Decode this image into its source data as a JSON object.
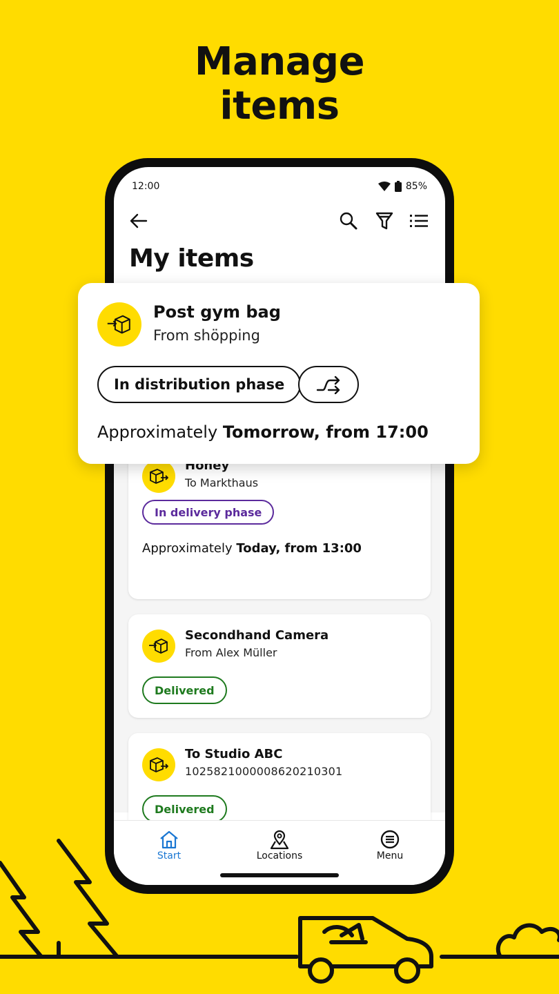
{
  "headline": {
    "line1": "Manage",
    "line2": "items"
  },
  "status_bar": {
    "time": "12:00",
    "battery": "85%"
  },
  "app_bar": {
    "back_icon": "arrow-left-icon",
    "actions": [
      "search-icon",
      "filter-icon",
      "list-icon"
    ]
  },
  "page_title": "My items",
  "featured_item": {
    "title": "Post gym bag",
    "subtitle": "From shöpping",
    "status": "In distribution phase",
    "eta_prefix": "Approximately",
    "eta_value": "Tomorrow, from 17:00",
    "icon": "incoming-package-icon",
    "action_icon": "redirect-icon"
  },
  "items": [
    {
      "title": "Honey",
      "subtitle": "To Markthaus",
      "status": "In delivery phase",
      "eta_prefix": "Approximately",
      "eta_value": "Today, from 13:00",
      "icon": "outgoing-package-icon"
    },
    {
      "title": "Secondhand Camera",
      "subtitle": "From Alex Müller",
      "status": "Delivered",
      "icon": "incoming-package-icon"
    },
    {
      "title": "To Studio ABC",
      "subtitle": "1025821000008620210301",
      "status": "Delivered",
      "icon": "outgoing-package-icon"
    }
  ],
  "bottom_nav": [
    {
      "label": "Start",
      "icon": "home-icon",
      "active": true
    },
    {
      "label": "Locations",
      "icon": "map-pin-icon",
      "active": false
    },
    {
      "label": "Menu",
      "icon": "menu-icon",
      "active": false
    }
  ],
  "colors": {
    "brand_yellow": "#FFDC00",
    "delivery_purple": "#5B2A9C",
    "delivered_green": "#1E7A1E",
    "active_blue": "#1976D2"
  }
}
